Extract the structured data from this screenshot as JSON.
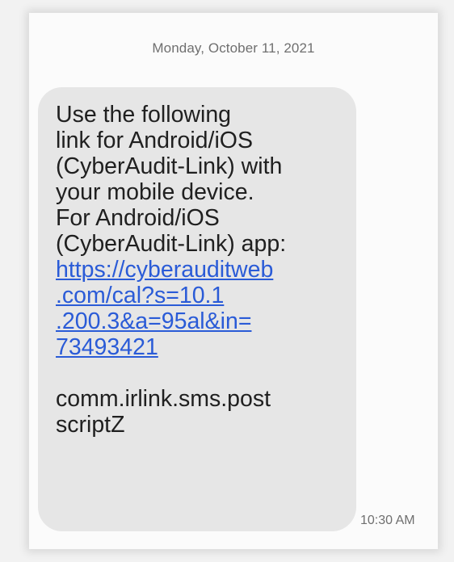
{
  "conversation": {
    "date_header": "Monday, October 11, 2021",
    "message": {
      "intro_lines": [
        "Use the following",
        "link for Android/iOS",
        "(CyberAudit-Link) with",
        "your mobile device.",
        "For Android/iOS",
        "(CyberAudit-Link) app:"
      ],
      "link_lines": [
        "https://cyberauditweb",
        ".com/cal?s=10.1",
        ".200.3&a=95al&in=",
        "73493421"
      ],
      "footer_lines": [
        "comm.irlink.sms.post",
        "scriptZ"
      ],
      "time": "10:30 AM"
    }
  },
  "colors": {
    "bubble_background": "#e6e6e6",
    "link": "#2a5bd7",
    "text": "#202020",
    "meta_text": "#6f6f6f"
  }
}
